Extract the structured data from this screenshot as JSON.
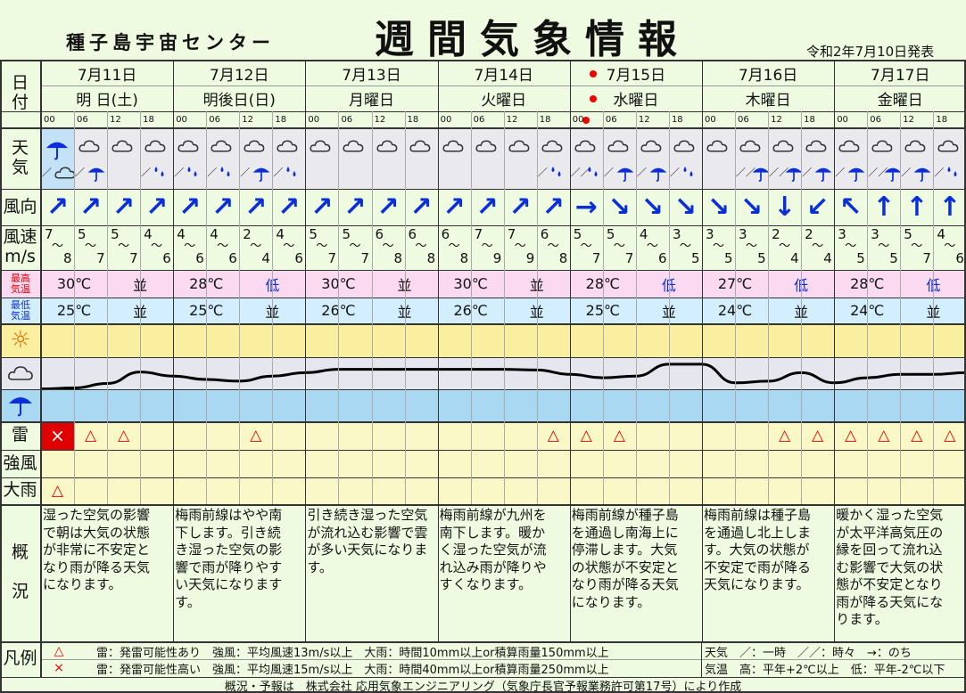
{
  "header": {
    "org": "種子島宇宙センター",
    "title": "週間気象情報",
    "issued": "令和2年7月10日発表"
  },
  "row_labels": {
    "date": "日\n付",
    "weather": "天\n気",
    "wind_dir": "風向",
    "wind_speed": "風速\nm/s",
    "max_temp": "最高\n気温",
    "min_temp": "最低\n気温",
    "thunder": "雷",
    "strong_wind": "強風",
    "heavy_rain": "大雨",
    "summary": "概\n\n況",
    "legend": "凡例"
  },
  "hours": [
    "00",
    "06",
    "12",
    "18"
  ],
  "days": [
    {
      "date": "7月11日",
      "name": "明 日(土)",
      "dot": false,
      "max": "30℃",
      "max_cmp": "並",
      "min": "25℃",
      "min_cmp": "並",
      "summary": "湿った空気の影響\nで朝は大気の状態\nが非常に不安定と\nなり雨が降る天気\nになります。"
    },
    {
      "date": "7月12日",
      "name": "明後日(日)",
      "dot": false,
      "max": "28℃",
      "max_cmp": "低",
      "min": "25℃",
      "min_cmp": "並",
      "summary": "梅雨前線はやや南\n下します。引き続\nき湿った空気の影\n響で雨が降りやす\nい天気になります\nす。"
    },
    {
      "date": "7月13日",
      "name": "月曜日",
      "dot": false,
      "max": "30℃",
      "max_cmp": "並",
      "min": "26℃",
      "min_cmp": "並",
      "summary": "引き続き湿った空気\nが流れ込む影響で雲\nが多い天気になりま\nす。"
    },
    {
      "date": "7月14日",
      "name": "火曜日",
      "dot": false,
      "max": "30℃",
      "max_cmp": "並",
      "min": "26℃",
      "min_cmp": "並",
      "summary": "梅雨前線が九州を\n南下します。暖か\nく湿った空気が流\nれ込み雨が降りや\nすくなります。"
    },
    {
      "date": "7月15日",
      "name": "水曜日",
      "dot": true,
      "max": "28℃",
      "max_cmp": "低",
      "min": "25℃",
      "min_cmp": "並",
      "summary": "梅雨前線が種子島\nを通過し南海上に\n停滞します。大気\nの状態が不安定と\nなり雨が降る天気\nになります。"
    },
    {
      "date": "7月16日",
      "name": "木曜日",
      "dot": false,
      "max": "27℃",
      "max_cmp": "低",
      "min": "24℃",
      "min_cmp": "並",
      "summary": "梅雨前線は種子島\nを通過し北上しま\nす。大気の状態が\n不安定で雨が降る\n天気になります。"
    },
    {
      "date": "7月17日",
      "name": "金曜日",
      "dot": false,
      "max": "28℃",
      "max_cmp": "低",
      "min": "24℃",
      "min_cmp": "並",
      "summary": "暖かく湿った空気\nが太平洋高気圧の\n縁を回って流れ込\nむ影響で大気の状\n態が不安定となり\n雨が降る天気にな\nります。"
    }
  ],
  "slots": {
    "weather": [
      [
        "umbrella",
        "／",
        "cloud"
      ],
      [
        "cloud",
        "／",
        "umbrella"
      ],
      [
        "cloud",
        "",
        ""
      ],
      [
        "cloud",
        "／",
        "rain-drops"
      ],
      [
        "cloud",
        "／",
        "rain-drops"
      ],
      [
        "cloud",
        "／",
        "rain-drops"
      ],
      [
        "cloud",
        "／",
        "umbrella"
      ],
      [
        "cloud",
        "／",
        "rain-drops"
      ],
      [
        "cloud",
        "",
        ""
      ],
      [
        "cloud",
        "",
        ""
      ],
      [
        "cloud",
        "",
        ""
      ],
      [
        "cloud",
        "",
        ""
      ],
      [
        "cloud",
        "",
        ""
      ],
      [
        "cloud",
        "",
        ""
      ],
      [
        "cloud",
        "",
        ""
      ],
      [
        "cloud",
        "／",
        "rain-drops"
      ],
      [
        "cloud",
        "／／",
        "rain-drops"
      ],
      [
        "cloud",
        "／",
        "umbrella"
      ],
      [
        "cloud",
        "／",
        "umbrella"
      ],
      [
        "cloud",
        "／",
        "rain-drops"
      ],
      [
        "cloud",
        "",
        ""
      ],
      [
        "cloud",
        "／／",
        "umbrella"
      ],
      [
        "cloud",
        "／／",
        "umbrella"
      ],
      [
        "cloud",
        "／",
        "umbrella"
      ],
      [
        "cloud",
        "／",
        "umbrella"
      ],
      [
        "cloud",
        "／／",
        "umbrella"
      ],
      [
        "cloud",
        "／",
        "umbrella"
      ],
      [
        "cloud",
        "／",
        "rain-drops"
      ]
    ],
    "wind_dir": [
      "NE",
      "NE",
      "NE",
      "NE",
      "NE",
      "NE",
      "NE",
      "NE",
      "NE",
      "NE",
      "NE",
      "NE",
      "NE",
      "NE",
      "NE",
      "NE",
      "E",
      "SE",
      "SE",
      "SE",
      "SE",
      "SE",
      "S",
      "SW",
      "NW",
      "N",
      "N",
      "N"
    ],
    "wind_speed": [
      [
        "7",
        "8"
      ],
      [
        "5",
        "7"
      ],
      [
        "5",
        "7"
      ],
      [
        "4",
        "6"
      ],
      [
        "4",
        "6"
      ],
      [
        "4",
        "6"
      ],
      [
        "2",
        "4"
      ],
      [
        "4",
        "6"
      ],
      [
        "5",
        "7"
      ],
      [
        "5",
        "7"
      ],
      [
        "6",
        "8"
      ],
      [
        "6",
        "8"
      ],
      [
        "6",
        "8"
      ],
      [
        "7",
        "9"
      ],
      [
        "7",
        "9"
      ],
      [
        "6",
        "8"
      ],
      [
        "5",
        "7"
      ],
      [
        "5",
        "7"
      ],
      [
        "4",
        "6"
      ],
      [
        "3",
        "5"
      ],
      [
        "3",
        "5"
      ],
      [
        "3",
        "5"
      ],
      [
        "2",
        "4"
      ],
      [
        "2",
        "4"
      ],
      [
        "3",
        "5"
      ],
      [
        "3",
        "5"
      ],
      [
        "5",
        "7"
      ],
      [
        "4",
        "6"
      ]
    ],
    "thunder": [
      "×",
      "△",
      "△",
      "",
      "",
      "",
      "△",
      "",
      "",
      "",
      "",
      "",
      "",
      "",
      "",
      "△",
      "△",
      "△",
      "",
      "",
      "",
      "",
      "△",
      "△",
      "△",
      "△",
      "△",
      "△"
    ],
    "strong_wind": [
      "",
      "",
      "",
      "",
      "",
      "",
      "",
      "",
      "",
      "",
      "",
      "",
      "",
      "",
      "",
      "",
      "",
      "",
      "",
      "",
      "",
      "",
      "",
      "",
      "",
      "",
      "",
      ""
    ],
    "heavy_rain": [
      "△",
      "",
      "",
      "",
      "",
      "",
      "",
      "",
      "",
      "",
      "",
      "",
      "",
      "",
      "",
      "",
      "",
      "",
      "",
      "",
      "",
      "",
      "",
      "",
      "",
      "",
      "",
      ""
    ]
  },
  "trend_curve": [
    0.78,
    0.75,
    0.62,
    0.28,
    0.4,
    0.5,
    0.55,
    0.4,
    0.3,
    0.2,
    0.2,
    0.2,
    0.2,
    0.2,
    0.2,
    0.22,
    0.35,
    0.45,
    0.4,
    0.05,
    0.05,
    0.6,
    0.55,
    0.3,
    0.6,
    0.45,
    0.35,
    0.35,
    0.3
  ],
  "legend": {
    "row1_mark": "△",
    "row1_text": "雷：発雷可能性あり　強風：平均風速13m/s以上　大雨：時間10mm以上or積算雨量150mm以上",
    "row2_mark": "×",
    "row2_text": "雷：発雷可能性高い　強風：平均風速15m/s以上　大雨：時間40mm以上or積算雨量250mm以上",
    "weather_line": "天気　／：一時　／／：時々　→：のち",
    "temp_line": "気温　高：平年+2℃以上　低：平年-2℃以下"
  },
  "footer": "概況・予報は　株式会社 応用気象エンジニアリング（気象庁長官予報業務許可第17号）により作成",
  "colors": {
    "max_bg": "#fbd9f0",
    "min_bg": "#d3efff",
    "sun_bg": "#f9ef9e",
    "cloud_bg": "#e6e6ef",
    "rain_bg": "#a9d8f3",
    "warn_bg": "#fbf8c8",
    "alert": "#e00000",
    "accent": "#0a2fd8"
  }
}
